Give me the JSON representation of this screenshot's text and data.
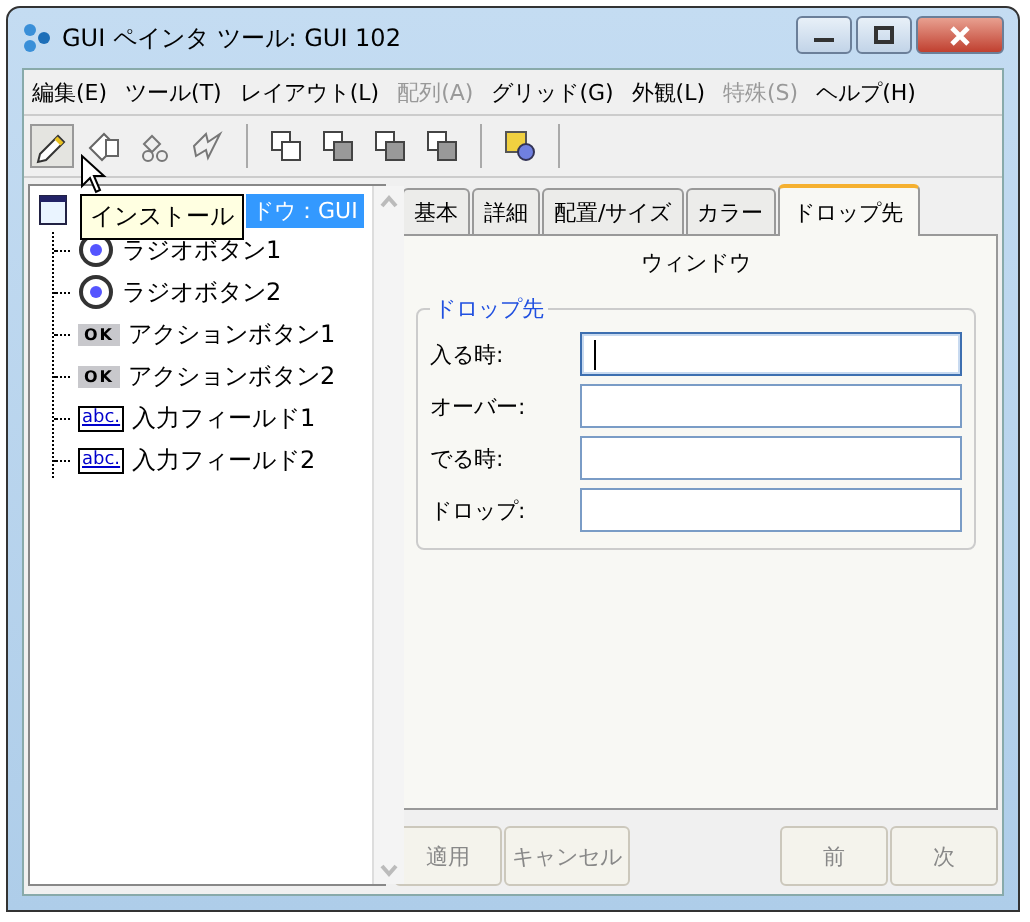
{
  "window": {
    "title": "GUI ペインタ ツール: GUI 102"
  },
  "menu": [
    {
      "label": "編集(E)",
      "disabled": false
    },
    {
      "label": "ツール(T)",
      "disabled": false
    },
    {
      "label": "レイアウト(L)",
      "disabled": false
    },
    {
      "label": "配列(A)",
      "disabled": true
    },
    {
      "label": "グリッド(G)",
      "disabled": false
    },
    {
      "label": "外観(L)",
      "disabled": false
    },
    {
      "label": "特殊(S)",
      "disabled": true
    },
    {
      "label": "ヘルプ(H)",
      "disabled": false
    }
  ],
  "toolbar": [
    {
      "kind": "pencil",
      "pressed": true
    },
    {
      "kind": "eraser",
      "pressed": false
    },
    {
      "kind": "links",
      "pressed": false
    },
    {
      "kind": "bolt",
      "pressed": false
    },
    {
      "kind": "sep"
    },
    {
      "kind": "front",
      "pressed": false
    },
    {
      "kind": "back",
      "pressed": false
    },
    {
      "kind": "forward",
      "pressed": false
    },
    {
      "kind": "backward",
      "pressed": false
    },
    {
      "kind": "sep"
    },
    {
      "kind": "cube",
      "pressed": false
    },
    {
      "kind": "sep"
    }
  ],
  "tooltip": "インストール",
  "tree": {
    "label": "ドウ：GUI",
    "selected": true,
    "children": [
      {
        "kind": "radio",
        "label": "ラジオボタン1"
      },
      {
        "kind": "radio",
        "label": "ラジオボタン2"
      },
      {
        "kind": "action",
        "label": "アクションボタン1",
        "icon_text": "OK"
      },
      {
        "kind": "action",
        "label": "アクションボタン2",
        "icon_text": "OK"
      },
      {
        "kind": "input",
        "label": "入力フィールド1",
        "icon_text": "abc."
      },
      {
        "kind": "input",
        "label": "入力フィールド2",
        "icon_text": "abc."
      }
    ]
  },
  "tabs": [
    {
      "label": "基本",
      "selected": false
    },
    {
      "label": "詳細",
      "selected": false
    },
    {
      "label": "配置/サイズ",
      "selected": false
    },
    {
      "label": "カラー",
      "selected": false
    },
    {
      "label": "ドロップ先",
      "selected": true
    }
  ],
  "panel_title": "ウィンドウ",
  "group": {
    "title": "ドロップ先",
    "fields": [
      {
        "label": "入る時:",
        "focused": true
      },
      {
        "label": "オーバー:",
        "focused": false
      },
      {
        "label": "でる時:",
        "focused": false
      },
      {
        "label": "ドロップ:",
        "focused": false
      }
    ]
  },
  "buttons_left": [
    {
      "label": "適用",
      "disabled": true
    },
    {
      "label": "キャンセル",
      "disabled": true
    }
  ],
  "buttons_right": [
    {
      "label": "前",
      "disabled": true
    },
    {
      "label": "次",
      "disabled": true
    }
  ]
}
